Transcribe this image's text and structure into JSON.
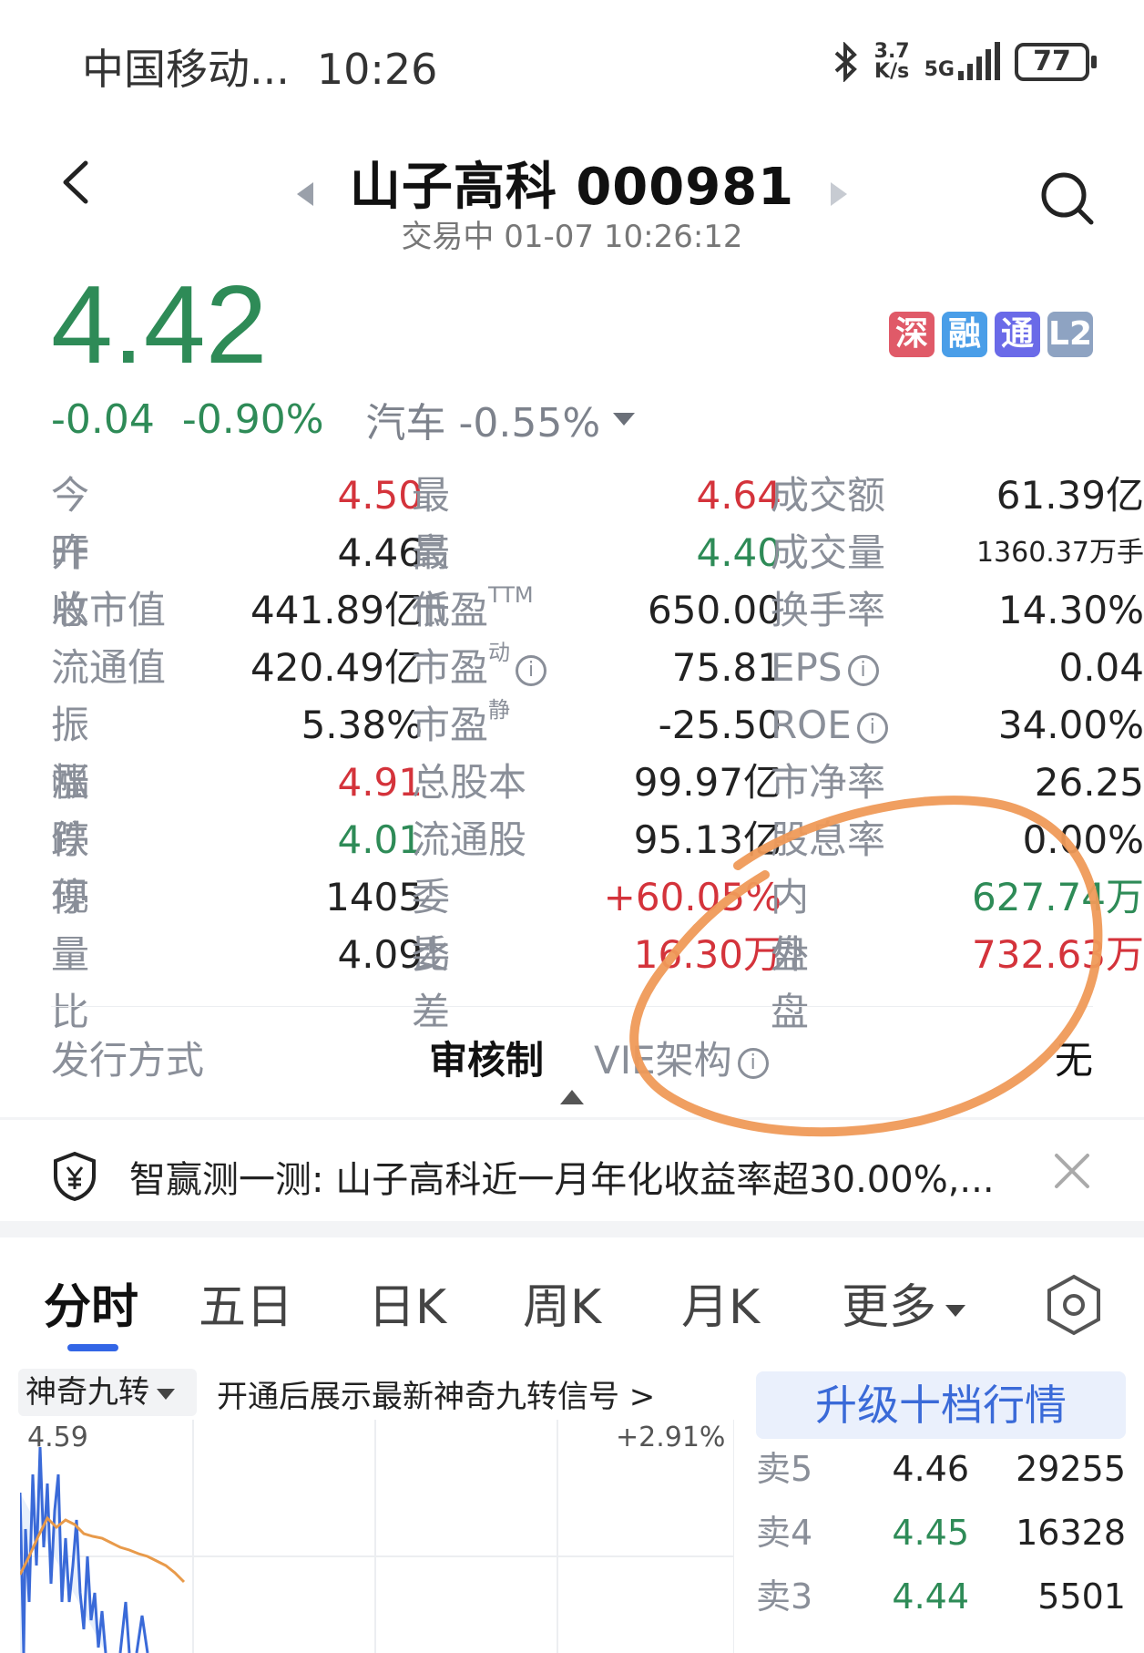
{
  "status_bar": {
    "carrier": "中国移动...",
    "time": "10:26",
    "net_speed_value": "3.7",
    "net_speed_unit": "K/s",
    "network": "5G",
    "battery": "77"
  },
  "header": {
    "title": "山子高科 000981",
    "subtitle": "交易中 01-07 10:26:12"
  },
  "price": {
    "last": "4.42",
    "change": "-0.04",
    "change_pct": "-0.90%",
    "sector": "汽车",
    "sector_change": "-0.55%"
  },
  "badges": [
    {
      "label": "深",
      "color": "#e05a68"
    },
    {
      "label": "融",
      "color": "#4a9ee8"
    },
    {
      "label": "通",
      "color": "#6a6ae8"
    },
    {
      "label": "L2",
      "color": "#8ea3c2"
    }
  ],
  "quote": {
    "open_label": "今开",
    "open": "4.50",
    "high_label": "最高",
    "high": "4.64",
    "turnover_label": "成交额",
    "turnover": "61.39亿",
    "prev_close_label": "昨收",
    "prev_close": "4.46",
    "low_label": "最低",
    "low": "4.40",
    "volume_label": "成交量",
    "volume": "1360.37万手",
    "market_cap_label": "总市值",
    "market_cap": "441.89亿",
    "pe_ttm_label": "市盈",
    "pe_ttm_sup": "TTM",
    "pe_ttm": "650.00",
    "turnover_rate_label": "换手率",
    "turnover_rate": "14.30%",
    "float_cap_label": "流通值",
    "float_cap": "420.49亿",
    "pe_dyn_label": "市盈",
    "pe_dyn_sup": "动",
    "pe_dyn": "75.81",
    "eps_label": "EPS",
    "eps": "0.04",
    "amplitude_label": "振幅",
    "amplitude": "5.38%",
    "pe_static_label": "市盈",
    "pe_static_sup": "静",
    "pe_static": "-25.50",
    "roe_label": "ROE",
    "roe": "34.00%",
    "limit_up_label": "涨停",
    "limit_up": "4.91",
    "total_shares_label": "总股本",
    "total_shares": "99.97亿",
    "pb_label": "市净率",
    "pb": "26.25",
    "limit_down_label": "跌停",
    "limit_down": "4.01",
    "float_shares_label": "流通股",
    "float_shares": "95.13亿",
    "dividend_label": "股息率",
    "dividend": "0.00%",
    "current_vol_label": "现量",
    "current_vol": "1405",
    "bid_ratio_label": "委比",
    "bid_ratio": "+60.05%",
    "inner_label": "内盘",
    "inner": "627.74万",
    "vol_ratio_label": "量比",
    "vol_ratio": "4.09",
    "bid_diff_label": "委差",
    "bid_diff": "16.30万",
    "outer_label": "外盘",
    "outer": "732.63万"
  },
  "issuance": {
    "label": "发行方式",
    "value": "审核制",
    "vie_label": "VIE架构",
    "vie_value": "无"
  },
  "notice": {
    "text": "智赢测一测: 山子高科近一月年化收益率超30.00%,..."
  },
  "tabs": [
    "分时",
    "五日",
    "日K",
    "周K",
    "月K",
    "更多"
  ],
  "indicator": {
    "name": "神奇九转",
    "link": "开通后展示最新神奇九转信号 >"
  },
  "chart": {
    "high_label": "4.59",
    "pct_label": "+2.91%"
  },
  "order_book": {
    "upgrade_label": "升级十档行情",
    "rows": [
      {
        "label": "卖5",
        "price": "4.46",
        "volume": "29255"
      },
      {
        "label": "卖4",
        "price": "4.45",
        "volume": "16328"
      },
      {
        "label": "卖3",
        "price": "4.44",
        "volume": "5501"
      }
    ]
  },
  "colors": {
    "up": "#d4333b",
    "down": "#2e8b57",
    "accent": "#3366e6",
    "annotation": "#f0a060"
  }
}
